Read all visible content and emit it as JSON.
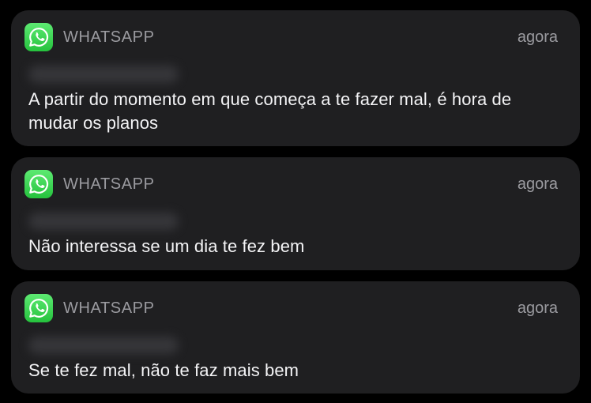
{
  "notifications": [
    {
      "app_name": "WHATSAPP",
      "time": "agora",
      "app_icon": "whatsapp-icon",
      "message": "A partir do momento em que começa a te fazer mal, é hora de mudar os planos"
    },
    {
      "app_name": "WHATSAPP",
      "time": "agora",
      "app_icon": "whatsapp-icon",
      "message": "Não interessa se um dia te fez bem"
    },
    {
      "app_name": "WHATSAPP",
      "time": "agora",
      "app_icon": "whatsapp-icon",
      "message": "Se te fez mal, não te faz mais bem"
    }
  ],
  "colors": {
    "background": "#000000",
    "card": "#1f1f21",
    "secondary_text": "#9b9ba0",
    "primary_text": "#f4f4f6",
    "whatsapp_green": "#25c23d"
  }
}
